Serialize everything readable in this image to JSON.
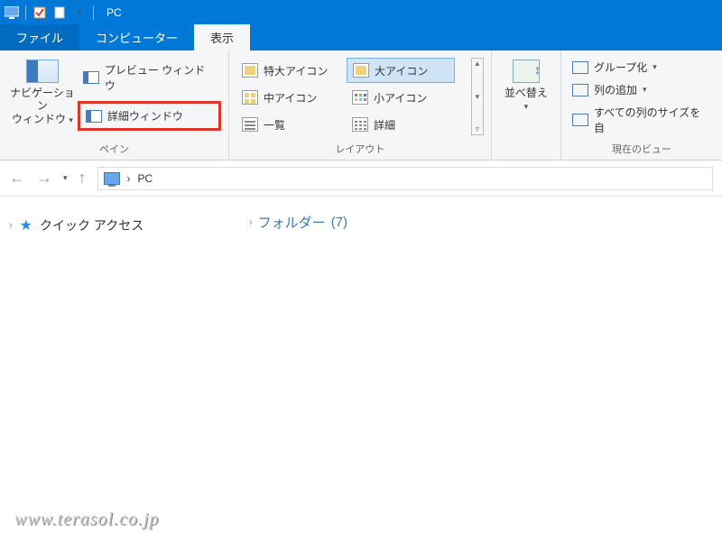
{
  "titlebar": {
    "title": "PC"
  },
  "tabs": {
    "file": "ファイル",
    "computer": "コンピューター",
    "view": "表示"
  },
  "ribbon": {
    "pane": {
      "nav_button": "ナビゲーション\nウィンドウ",
      "preview": "プレビュー ウィンドウ",
      "details": "詳細ウィンドウ",
      "group_label": "ペイン"
    },
    "layout": {
      "extra_large": "特大アイコン",
      "large": "大アイコン",
      "medium": "中アイコン",
      "small": "小アイコン",
      "list": "一覧",
      "details": "詳細",
      "group_label": "レイアウト"
    },
    "sort": {
      "button": "並べ替え"
    },
    "current_view": {
      "group_by": "グループ化",
      "add_columns": "列の追加",
      "size_all": "すべての列のサイズを自",
      "group_label": "現在のビュー"
    }
  },
  "address": {
    "location": "PC",
    "sep": "›"
  },
  "sidebar": {
    "quick_access": "クイック アクセス"
  },
  "main": {
    "folders_label": "フォルダー",
    "folders_count": "(7)"
  },
  "watermark": "www.terasol.co.jp"
}
